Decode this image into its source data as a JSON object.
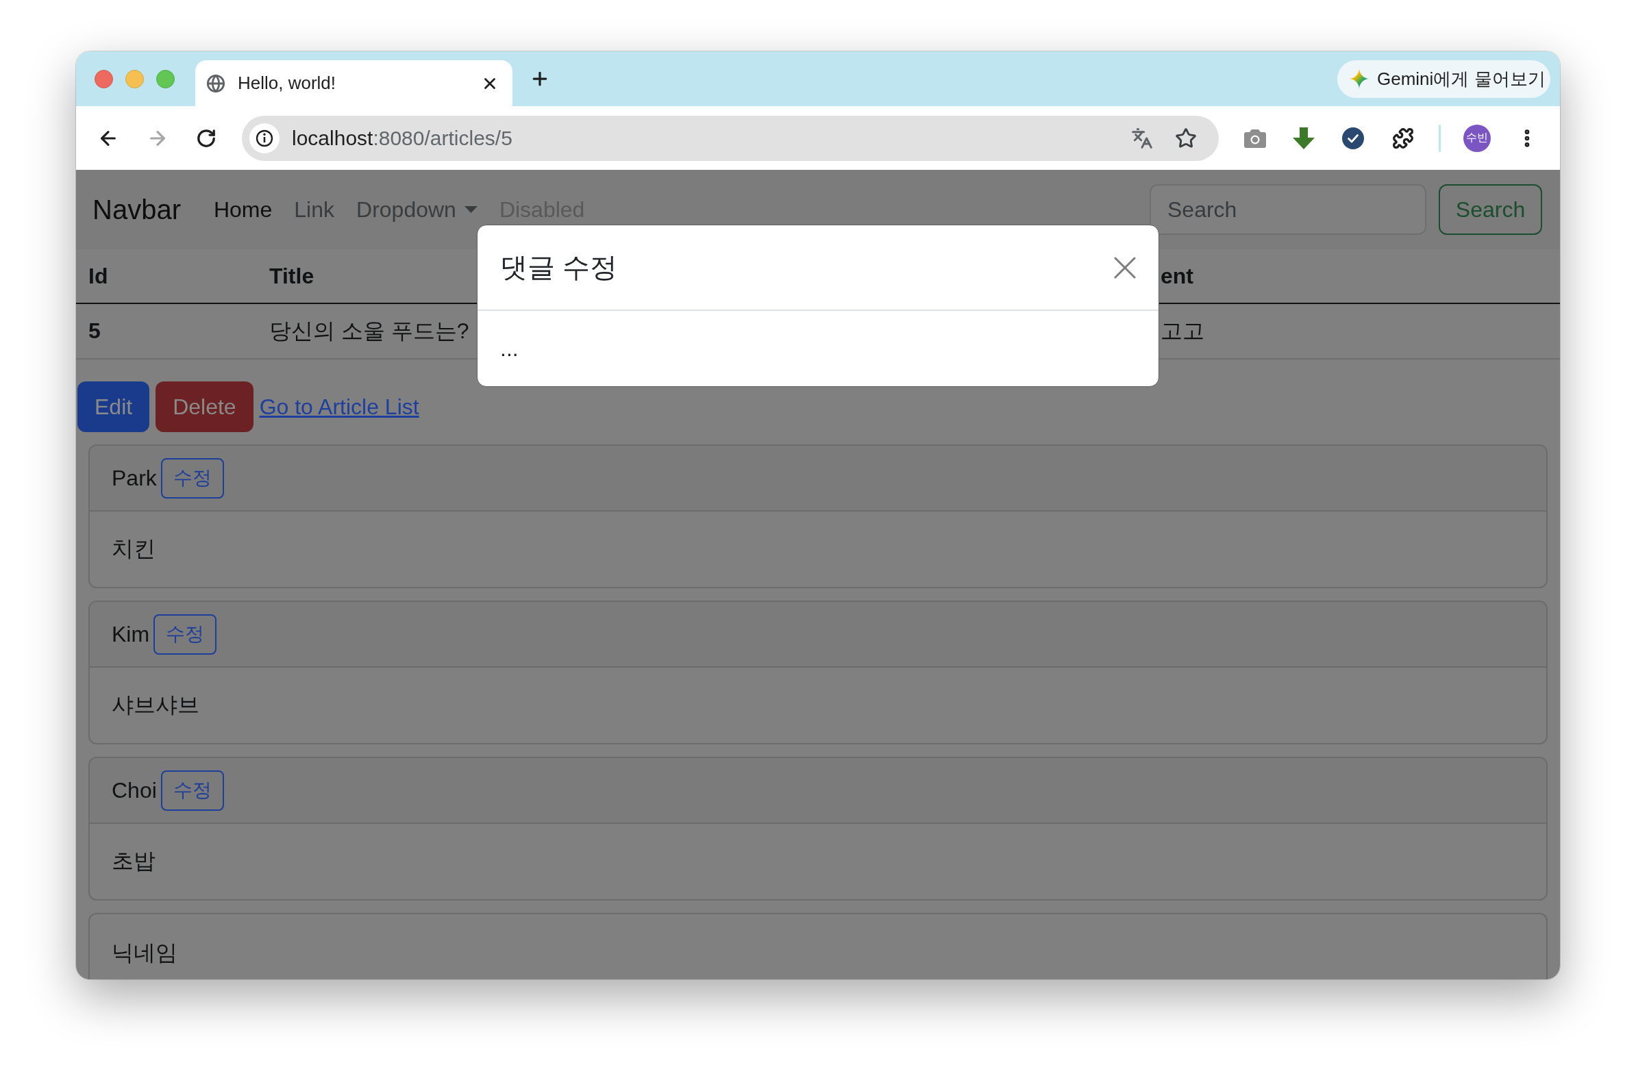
{
  "browser": {
    "tab": {
      "title": "Hello, world!",
      "selected": true
    },
    "gemini_button": "Gemini에게 물어보기",
    "navigation": {
      "back_enabled": true,
      "forward_enabled": false
    },
    "address_bar": {
      "host": "localhost",
      "path": ":8080/articles/5"
    },
    "profile_avatar": "수빈"
  },
  "navbar": {
    "brand": "Navbar",
    "links": [
      {
        "label": "Home",
        "kind": "link",
        "selected": true,
        "disabled": false
      },
      {
        "label": "Link",
        "kind": "link",
        "selected": false,
        "disabled": false
      },
      {
        "label": "Dropdown",
        "kind": "dropdown",
        "selected": false,
        "disabled": false
      },
      {
        "label": "Disabled",
        "kind": "link",
        "selected": false,
        "disabled": true
      }
    ],
    "search": {
      "placeholder": "Search",
      "button": "Search"
    }
  },
  "table": {
    "columns": [
      "Id",
      "Title",
      "ent"
    ],
    "rows": [
      [
        "5",
        "당신의 소울 푸드는?",
        "고고"
      ]
    ]
  },
  "actions": {
    "edit": "Edit",
    "delete": "Delete",
    "list_link": "Go to Article List"
  },
  "comments": [
    {
      "nickname": "Park",
      "edit_button": "수정",
      "text": "치킨"
    },
    {
      "nickname": "Kim",
      "edit_button": "수정",
      "text": "샤브샤브"
    },
    {
      "nickname": "Choi",
      "edit_button": "수정",
      "text": "초밥"
    }
  ],
  "comment_form": {
    "nickname_label": "닉네임"
  },
  "modal": {
    "title": "댓글 수정",
    "body": "..."
  }
}
